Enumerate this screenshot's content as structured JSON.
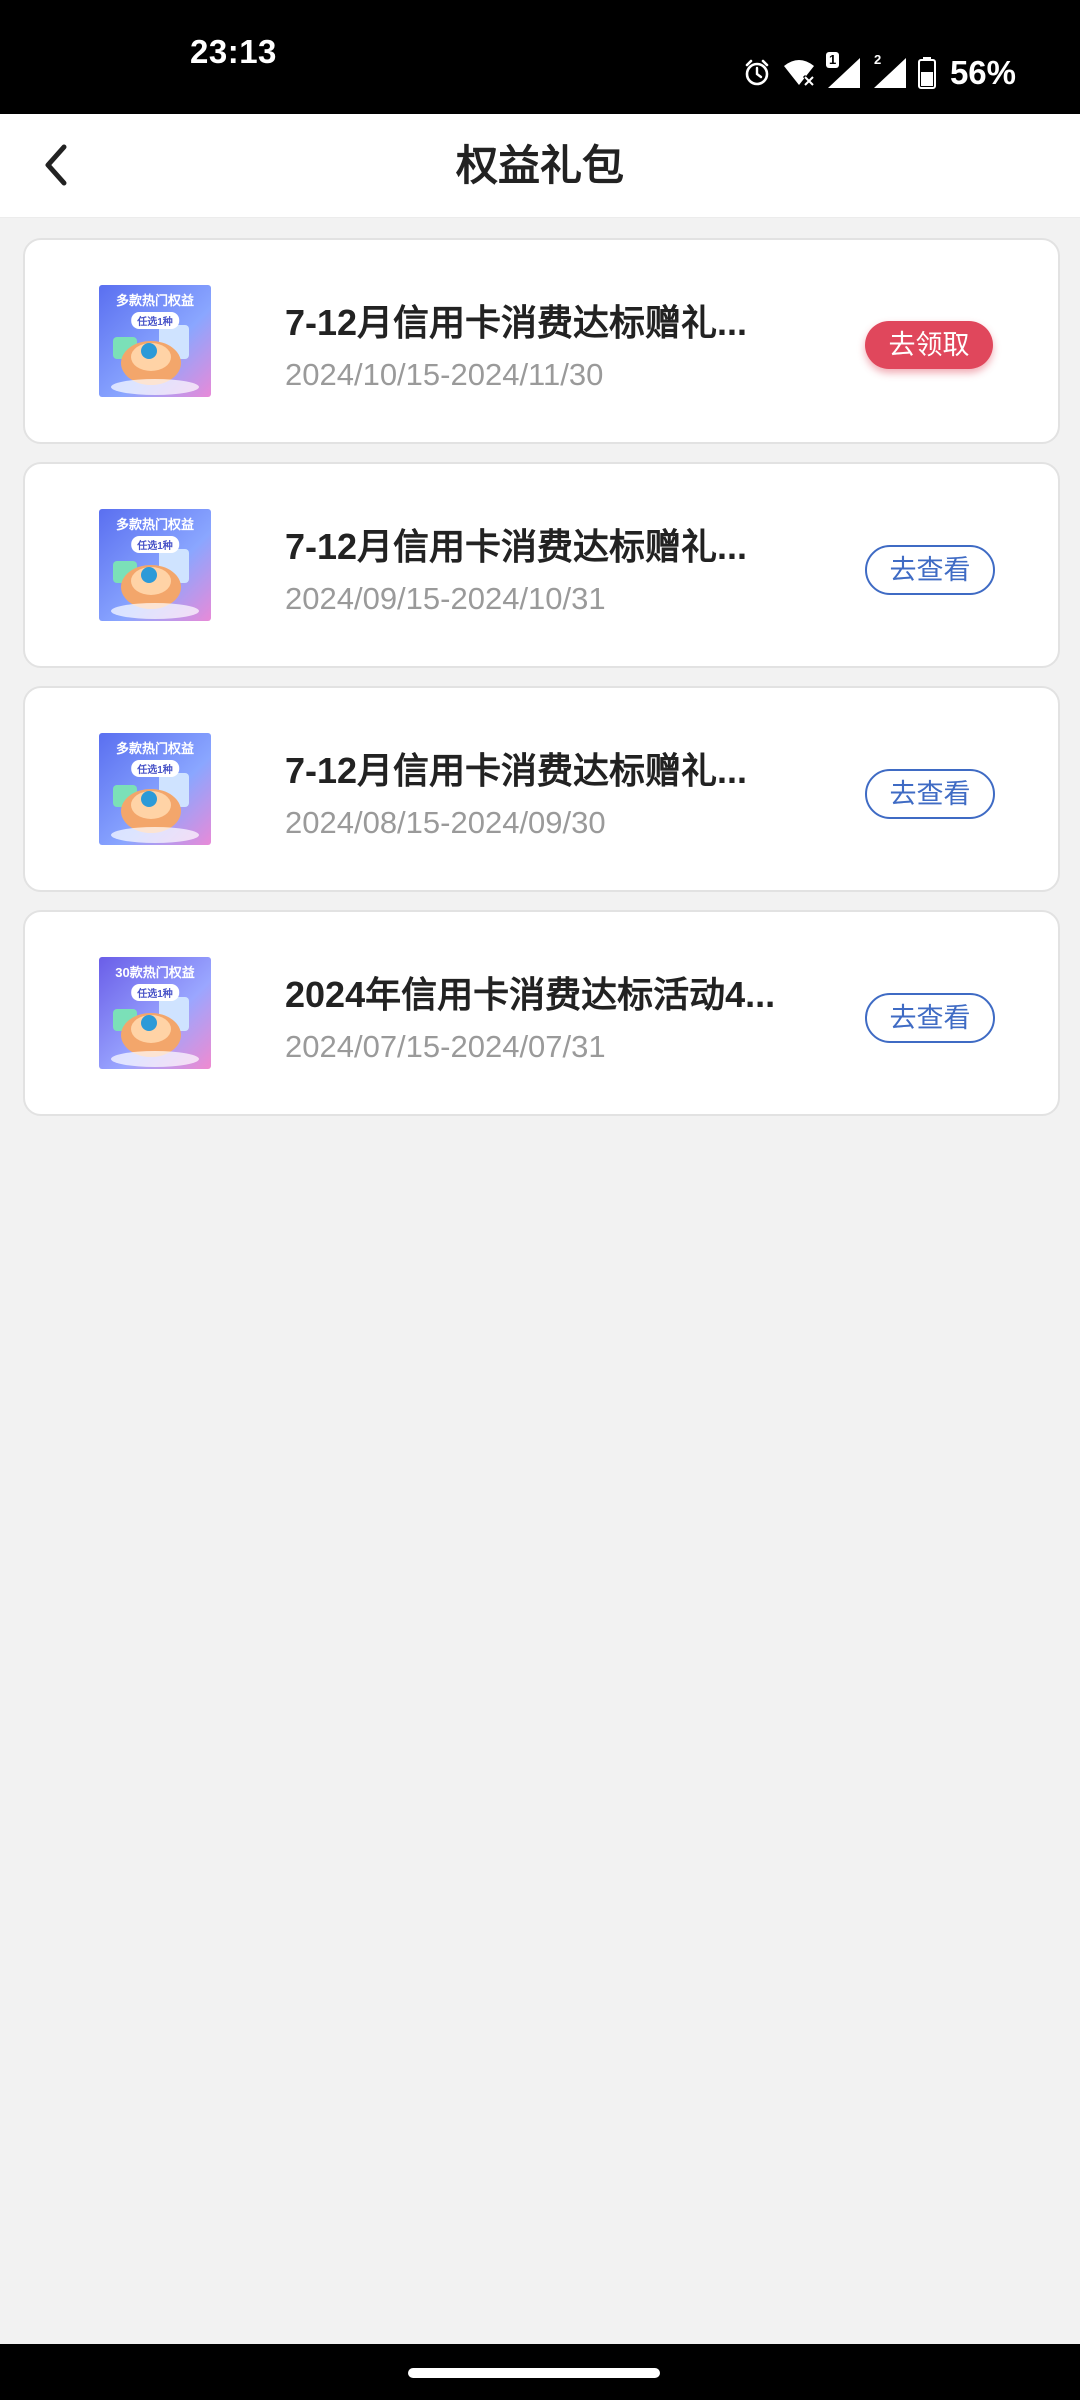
{
  "status_bar": {
    "time": "23:13",
    "icons": [
      "alarm-icon",
      "wifi-icon",
      "signal-sim1-icon",
      "signal-sim2-icon",
      "battery-icon"
    ],
    "sim1_badge": "1",
    "sim2_badge": "2",
    "battery": "56%"
  },
  "header": {
    "back_icon": "chevron-left-icon",
    "title": "权益礼包"
  },
  "items": [
    {
      "thumb_text": "多款热门权益",
      "thumb_sub": "任选1种",
      "title": "7-12月信用卡消费达标赠礼...",
      "date": "2024/10/15-2024/11/30",
      "button": "去领取",
      "button_style": "primary"
    },
    {
      "thumb_text": "多款热门权益",
      "thumb_sub": "任选1种",
      "title": "7-12月信用卡消费达标赠礼...",
      "date": "2024/09/15-2024/10/31",
      "button": "去查看",
      "button_style": "outline"
    },
    {
      "thumb_text": "多款热门权益",
      "thumb_sub": "任选1种",
      "title": "7-12月信用卡消费达标赠礼...",
      "date": "2024/08/15-2024/09/30",
      "button": "去查看",
      "button_style": "outline"
    },
    {
      "thumb_text": "30款热门权益",
      "thumb_sub": "任选1种",
      "title": "2024年信用卡消费达标活动4...",
      "date": "2024/07/15-2024/07/31",
      "button": "去查看",
      "button_style": "outline"
    }
  ],
  "colors": {
    "primary_button": "#e0475c",
    "outline_button": "#3f6bc4",
    "background": "#f2f2f2"
  }
}
